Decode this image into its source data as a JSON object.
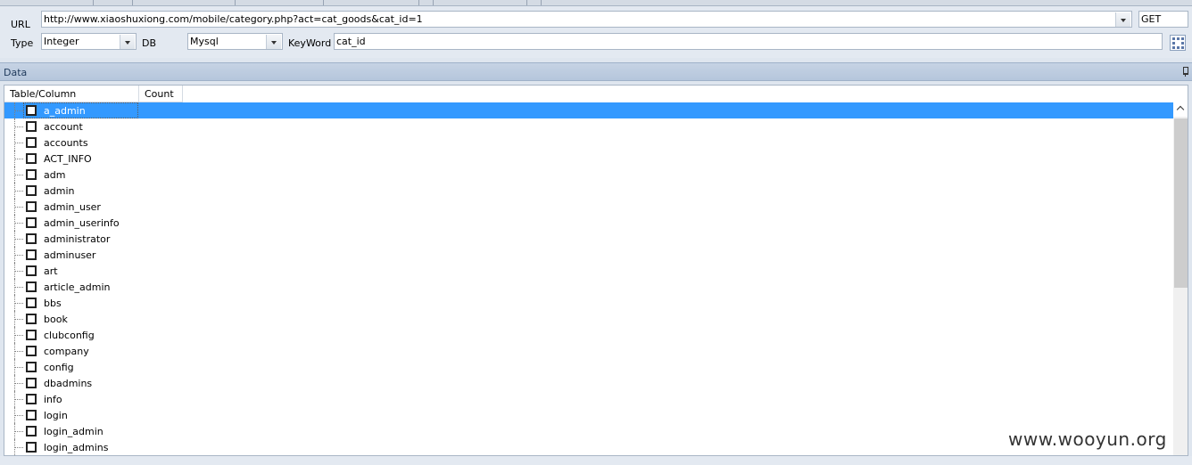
{
  "toolbar": {
    "url_label": "URL",
    "url_value": "http://www.xiaoshuxiong.com/mobile/category.php?act=cat_goods&cat_id=1",
    "method": "GET",
    "type_label": "Type",
    "type_value": "Integer",
    "db_label": "DB",
    "db_value": "Mysql",
    "keyword_label": "KeyWord",
    "keyword_value": "cat_id"
  },
  "panel": {
    "title": "Data"
  },
  "grid": {
    "columns": [
      "Table/Column",
      "Count"
    ],
    "rows": [
      "a_admin",
      "account",
      "accounts",
      "ACT_INFO",
      "adm",
      "admin",
      "admin_user",
      "admin_userinfo",
      "administrator",
      "adminuser",
      "art",
      "article_admin",
      "bbs",
      "book",
      "clubconfig",
      "company",
      "config",
      "dbadmins",
      "info",
      "login",
      "login_admin",
      "login_admins"
    ],
    "selected_index": 0
  },
  "watermark": "www.wooyun.org"
}
